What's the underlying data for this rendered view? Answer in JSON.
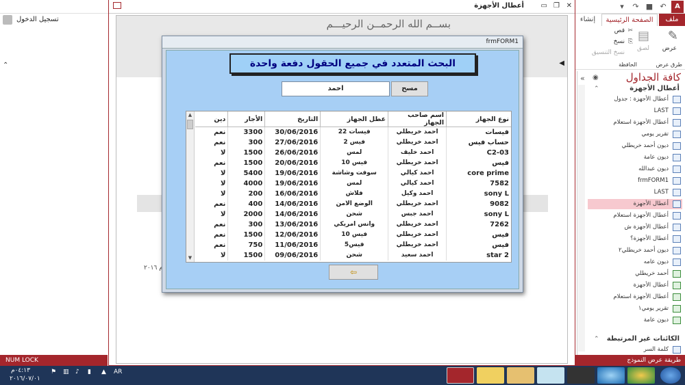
{
  "titlebar": {
    "window_title": "أعطال الأجهزة",
    "app_logo": "A",
    "quick_access": [
      "save-icon",
      "undo-icon",
      "redo-icon",
      "customize-icon"
    ],
    "controls": [
      "help-icon",
      "minimize-icon",
      "maximize-icon",
      "close-icon"
    ]
  },
  "tabs": {
    "file": "ملف",
    "home": "الصفحة الرئيسية",
    "create": "إنشاء"
  },
  "ribbon": {
    "view": "عرض",
    "views_group": "طرق عرض",
    "paste": "لصق",
    "cut": "قص",
    "copy": "نسخ",
    "format_painter": "نسخ التنسيق",
    "clipboard_group": "الحافظة"
  },
  "nav": {
    "title": "كافة الجداول",
    "group1": "أعطال الأجهزة",
    "group2": "الكائنات غير المرتبطة",
    "items": [
      {
        "label": "أعطال الأجهزة : جدول",
        "type": "table"
      },
      {
        "label": "LAST",
        "type": "form"
      },
      {
        "label": "أعطال الأجهزة استعلام",
        "type": "form"
      },
      {
        "label": "تقرير يومي",
        "type": "form"
      },
      {
        "label": "ديون أحمد خريطلي",
        "type": "form"
      },
      {
        "label": "ديون عامة",
        "type": "form"
      },
      {
        "label": "ديون عبدالله",
        "type": "form"
      },
      {
        "label": "frmFORM1",
        "type": "form"
      },
      {
        "label": "LAST",
        "type": "form"
      },
      {
        "label": "أعطال الأجهزة",
        "type": "form",
        "selected": true
      },
      {
        "label": "أعطال الأجهزة استعلام",
        "type": "form"
      },
      {
        "label": "أعطال الأجهزة ش",
        "type": "form"
      },
      {
        "label": "أعطال الأجهزة؟",
        "type": "form"
      },
      {
        "label": "ديون أحمد خريطلي٢",
        "type": "form"
      },
      {
        "label": "ديون عامه",
        "type": "form"
      },
      {
        "label": "أحمد خريطلي",
        "type": "report"
      },
      {
        "label": "أعطال الأجهزة",
        "type": "report"
      },
      {
        "label": "أعطال الأجهزة استعلام",
        "type": "report"
      },
      {
        "label": "تقرير يومي١",
        "type": "report"
      },
      {
        "label": "ديون عامة",
        "type": "report"
      },
      {
        "label": "كلمة السر",
        "type": "form"
      }
    ]
  },
  "left_pane": {
    "login": "تسجيل الدخول"
  },
  "status": {
    "left": "NUM LOCK",
    "right": "طريقة عرض النموذج"
  },
  "form": {
    "bismillah": "بســم الله الرحمــن الرحيـــم",
    "year_text": "م ٢٠١٦"
  },
  "modal": {
    "title": "frmFORM1",
    "heading": "البحث المتعدد في جميع الحقول دفعة واحدة",
    "search_value": "احمد",
    "clear_label": "مسح",
    "back_label": "⇦",
    "columns": [
      "نوع الجهاز",
      "اسم صاحب الجهاز",
      "عطل الجهاز",
      "التاريخ",
      "الأجار",
      "دين"
    ],
    "rows": [
      [
        "فيسات",
        "احمد خريطلي",
        "فيسات 22",
        "30/06/2016",
        "3300",
        "نعم"
      ],
      [
        "حساب فيس",
        "احمد خريطلي",
        "فيس 2",
        "27/06/2016",
        "300",
        "نعم"
      ],
      [
        "C2-03",
        "احمد خليف",
        "لمس",
        "26/06/2016",
        "1500",
        "لا"
      ],
      [
        "فيس",
        "احمد خريطلي",
        "فيس 10",
        "20/06/2016",
        "1500",
        "نعم"
      ],
      [
        "core prime",
        "احمد كيالي",
        "سوفت وشاشة",
        "19/06/2016",
        "5400",
        "لا"
      ],
      [
        "7582",
        "احمد كيالي",
        "لمس",
        "19/06/2016",
        "4000",
        "لا"
      ],
      [
        "sony L",
        "احمد وكيل",
        "فلاش",
        "16/06/2016",
        "200",
        "لا"
      ],
      [
        "9082",
        "احمد خريطلي",
        "الوضع الامن",
        "14/06/2016",
        "400",
        "نعم"
      ],
      [
        "sony L",
        "احمد جبس",
        "شحن",
        "14/06/2016",
        "2000",
        "لا"
      ],
      [
        "7262",
        "احمد خريطلي",
        "وانس امريكي",
        "13/06/2016",
        "300",
        "نعم"
      ],
      [
        "فيس",
        "احمد خريطلي",
        "فيس 10",
        "12/06/2016",
        "1500",
        "نعم"
      ],
      [
        "فيس",
        "احمد خريطلي",
        "فيس5",
        "11/06/2016",
        "750",
        "نعم"
      ],
      [
        "star 2",
        "احمد سعيد",
        "شحن",
        "09/06/2016",
        "1500",
        "لا"
      ]
    ]
  },
  "taskbar": {
    "lang": "AR",
    "time": "٠٤:١٣م",
    "date": "٢٠١٦/٠٧/٠١"
  }
}
